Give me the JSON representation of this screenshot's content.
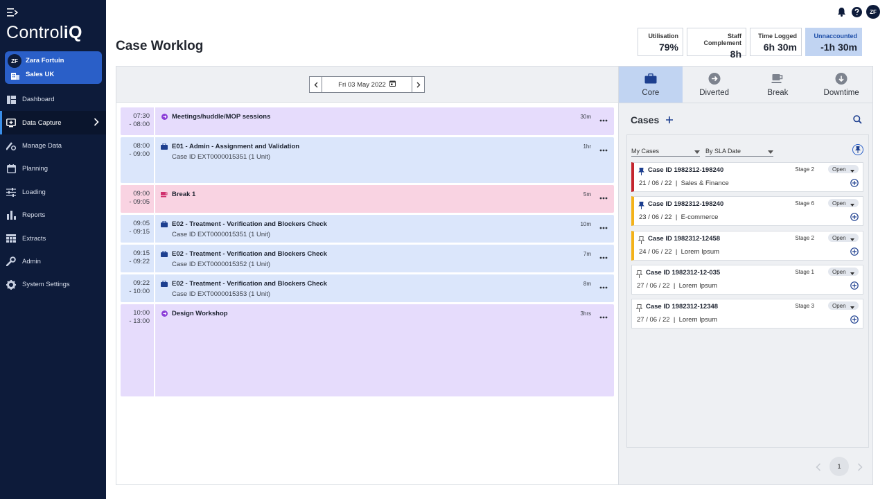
{
  "app": {
    "logo_light": "Control",
    "logo_bold": "iQ"
  },
  "user": {
    "initials": "ZF",
    "name": "Zara Fortuin",
    "team": "Sales UK"
  },
  "nav": {
    "items": [
      {
        "label": "Dashboard",
        "icon": "dashboard-icon"
      },
      {
        "label": "Data Capture",
        "icon": "data-capture-icon",
        "active": true
      },
      {
        "label": "Manage Data",
        "icon": "manage-data-icon"
      },
      {
        "label": "Planning",
        "icon": "calendar-icon"
      },
      {
        "label": "Loading",
        "icon": "sliders-icon"
      },
      {
        "label": "Reports",
        "icon": "bar-chart-icon"
      },
      {
        "label": "Extracts",
        "icon": "table-icon"
      },
      {
        "label": "Admin",
        "icon": "wrench-icon"
      },
      {
        "label": "System Settings",
        "icon": "gear-icon"
      }
    ]
  },
  "header": {
    "title": "Case Worklog",
    "avatar": "ZF"
  },
  "stats": [
    {
      "label": "Utilisation",
      "value": "79%"
    },
    {
      "label": "Staff Complement",
      "value": "8h"
    },
    {
      "label": "Time Logged",
      "value": "6h 30m"
    },
    {
      "label": "Unnaccounted",
      "value": "-1h 30m"
    }
  ],
  "date_picker": {
    "value": "Fri 03 May 2022"
  },
  "entries": [
    {
      "start": "07:30",
      "end": "- 08:00",
      "title": "Meetings/huddle/MOP sessions",
      "sub": "",
      "dur": "30m",
      "kind": "mtg"
    },
    {
      "start": "08:00",
      "end": "- 09:00",
      "title": "E01 - Admin - Assignment and Validation",
      "sub": "Case ID EXT0000015351   (1 Unit)",
      "dur": "1hr",
      "kind": "core"
    },
    {
      "start": "09:00",
      "end": "- 09:05",
      "title": "Break 1",
      "sub": "",
      "dur": "5m",
      "kind": "brk"
    },
    {
      "start": "09:05",
      "end": "- 09:15",
      "title": "E02 - Treatment - Verification and Blockers Check",
      "sub": "Case ID EXT0000015351   (1 Unit)",
      "dur": "10m",
      "kind": "core"
    },
    {
      "start": "09:15",
      "end": "- 09:22",
      "title": "E02 - Treatment - Verification and Blockers Check",
      "sub": "Case ID EXT0000015352   (1 Unit)",
      "dur": "7m",
      "kind": "core"
    },
    {
      "start": "09:22",
      "end": "- 10:00",
      "title": "E02 - Treatment - Verification and Blockers Check",
      "sub": "Case ID EXT0000015353   (1 Unit)",
      "dur": "8m",
      "kind": "core"
    },
    {
      "start": "10:00",
      "end": "- 13:00",
      "title": "Design Workshop",
      "sub": "",
      "dur": "3hrs",
      "kind": "mtg"
    }
  ],
  "tabs": [
    {
      "label": "Core",
      "icon": "briefcase-icon",
      "active": true
    },
    {
      "label": "Diverted",
      "icon": "arrow-right-circle-icon"
    },
    {
      "label": "Break",
      "icon": "coffee-icon"
    },
    {
      "label": "Downtime",
      "icon": "arrow-down-circle-icon"
    }
  ],
  "cases": {
    "title": "Cases",
    "filter_owner": "My Cases",
    "filter_sort": "By SLA Date",
    "items": [
      {
        "id": "Case ID 1982312-198240",
        "stage": "Stage 2",
        "status": "Open",
        "date": "21 / 06 / 22",
        "category": "Sales & Finance",
        "flag": "red",
        "pinned": true
      },
      {
        "id": "Case ID 1982312-198240",
        "stage": "Stage 6",
        "status": "Open",
        "date": "23 / 06 / 22",
        "category": "E-commerce",
        "flag": "amber",
        "pinned": true
      },
      {
        "id": "Case ID 1982312-12458",
        "stage": "Stage 2",
        "status": "Open",
        "date": "24 / 06 / 22",
        "category": "Lorem Ipsum",
        "flag": "amber",
        "pinned": false
      },
      {
        "id": "Case ID 1982312-12-035",
        "stage": "Stage 1",
        "status": "Open",
        "date": "27 / 06 / 22",
        "category": "Lorem Ipsum",
        "flag": "none",
        "pinned": false
      },
      {
        "id": "Case ID 1982312-12348",
        "stage": "Stage 3",
        "status": "Open",
        "date": "27 / 06 / 22",
        "category": "Lorem Ipsum",
        "flag": "none",
        "pinned": false
      }
    ]
  },
  "pager": {
    "current": "1"
  },
  "colors": {
    "sidebar": "#0d1b3a",
    "accent": "#2a5fc8",
    "core": "#dbe6fb",
    "break": "#f9d3e2",
    "meeting": "#e6dcfc",
    "flag_red": "#c4262e",
    "flag_amber": "#f3b21a"
  }
}
